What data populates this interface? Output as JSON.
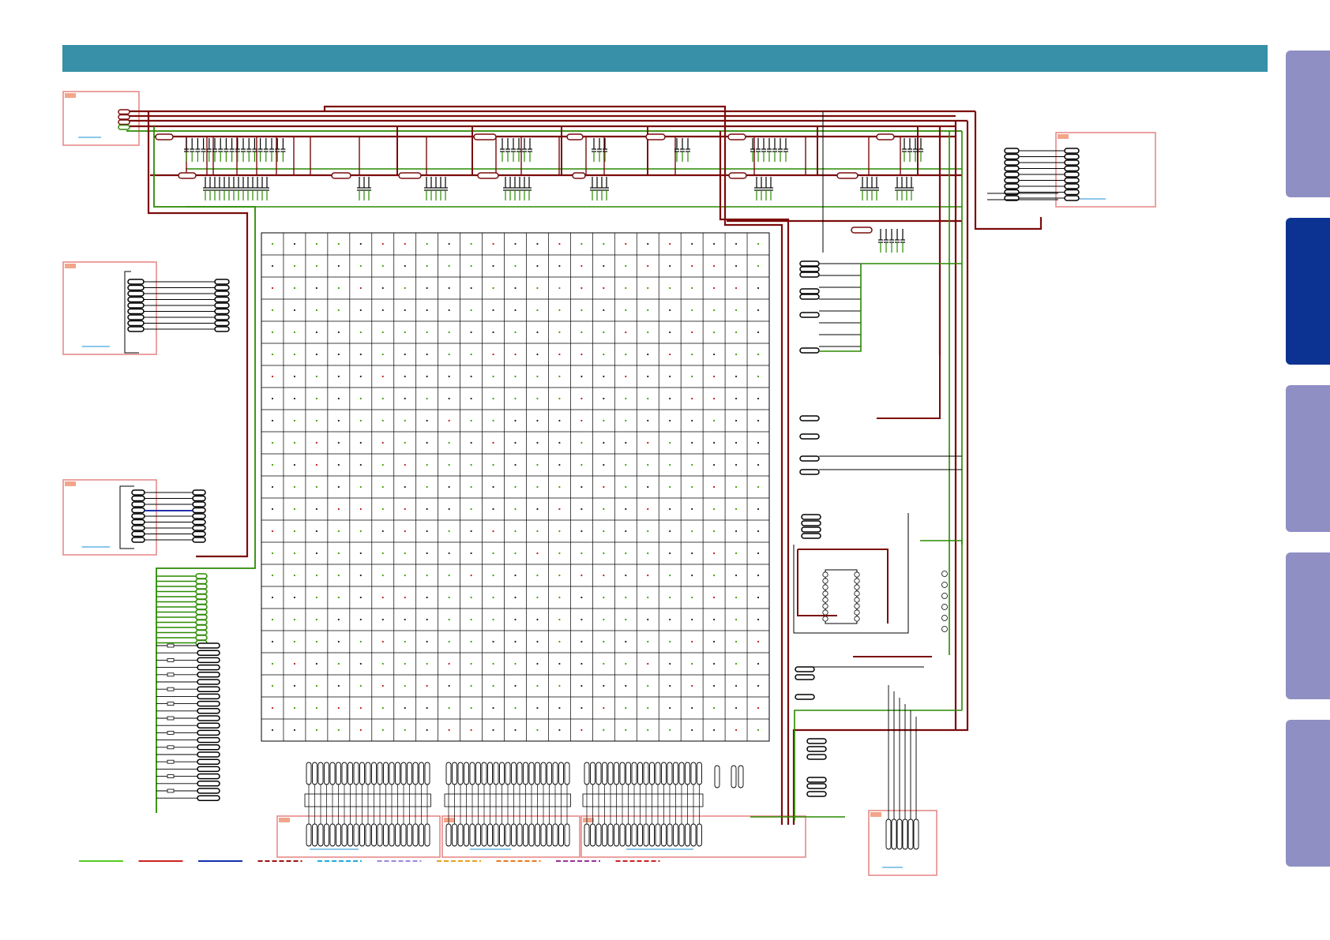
{
  "header": {
    "title": ""
  },
  "colors": {
    "header_bar": "#3790a8",
    "wire_dark_red": "#7b0b0b",
    "wire_green": "#2a8a00",
    "wire_black": "#000000",
    "block_outline": "#e88a8a",
    "block_tag": "#f2a58a",
    "ref_link": "#1a8fd6",
    "tab_inactive": "#8f8fc4",
    "tab_active": "#0d3392"
  },
  "side_tabs": [
    {
      "name": "tab-1",
      "active": false
    },
    {
      "name": "tab-2",
      "active": true
    },
    {
      "name": "tab-3",
      "active": false
    },
    {
      "name": "tab-4",
      "active": false
    },
    {
      "name": "tab-5",
      "active": false
    }
  ],
  "bga_grid": {
    "columns": 23,
    "rows": 23
  },
  "legend": [
    {
      "color": "#55cc22",
      "style": "solid"
    },
    {
      "color": "#cc2222",
      "style": "solid"
    },
    {
      "color": "#1133aa",
      "style": "solid"
    },
    {
      "color": "#991111",
      "style": "dashed"
    },
    {
      "color": "#22aadd",
      "style": "dashed"
    },
    {
      "color": "#9a88dd",
      "style": "dashed"
    },
    {
      "color": "#e8a020",
      "style": "dashed"
    },
    {
      "color": "#e87a20",
      "style": "dashed"
    },
    {
      "color": "#993399",
      "style": "dashed"
    },
    {
      "color": "#cc2222",
      "style": "dashed"
    }
  ]
}
